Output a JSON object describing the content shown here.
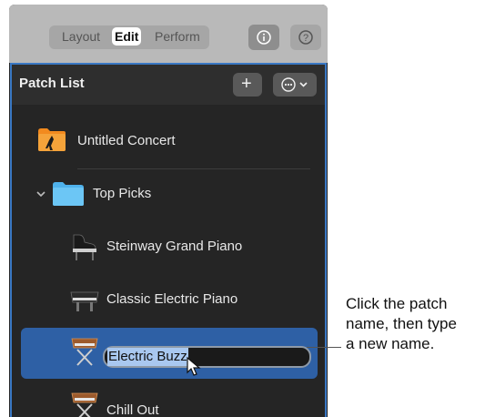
{
  "toolbar": {
    "tabs": [
      {
        "label": "Layout",
        "selected": false
      },
      {
        "label": "Edit",
        "selected": true
      },
      {
        "label": "Perform",
        "selected": false
      }
    ],
    "info_icon": "info-icon",
    "help_label": "?"
  },
  "patch_list": {
    "title": "Patch List",
    "add_label": "+",
    "more_icon": "ellipsis-circle-icon",
    "items": [
      {
        "label": "Untitled Concert",
        "icon": "concert-folder-icon"
      },
      {
        "label": "Top Picks",
        "icon": "folder-icon",
        "expanded": true
      },
      {
        "label": "Steinway Grand Piano",
        "icon": "grand-piano-icon"
      },
      {
        "label": "Classic Electric Piano",
        "icon": "electric-piano-icon"
      },
      {
        "label": "Electric Buzz",
        "icon": "synth-keyboard-icon",
        "selected": true,
        "editing": true
      },
      {
        "label": "Chill Out",
        "icon": "synth-keyboard-icon"
      }
    ]
  },
  "callout": {
    "lines": [
      "Click the patch",
      "name, then type",
      "a new name."
    ]
  },
  "colors": {
    "selection": "#2e60a5",
    "accent_border": "#3a78c4",
    "text_highlight": "#a9c8f0",
    "panel_bg": "#252525"
  }
}
